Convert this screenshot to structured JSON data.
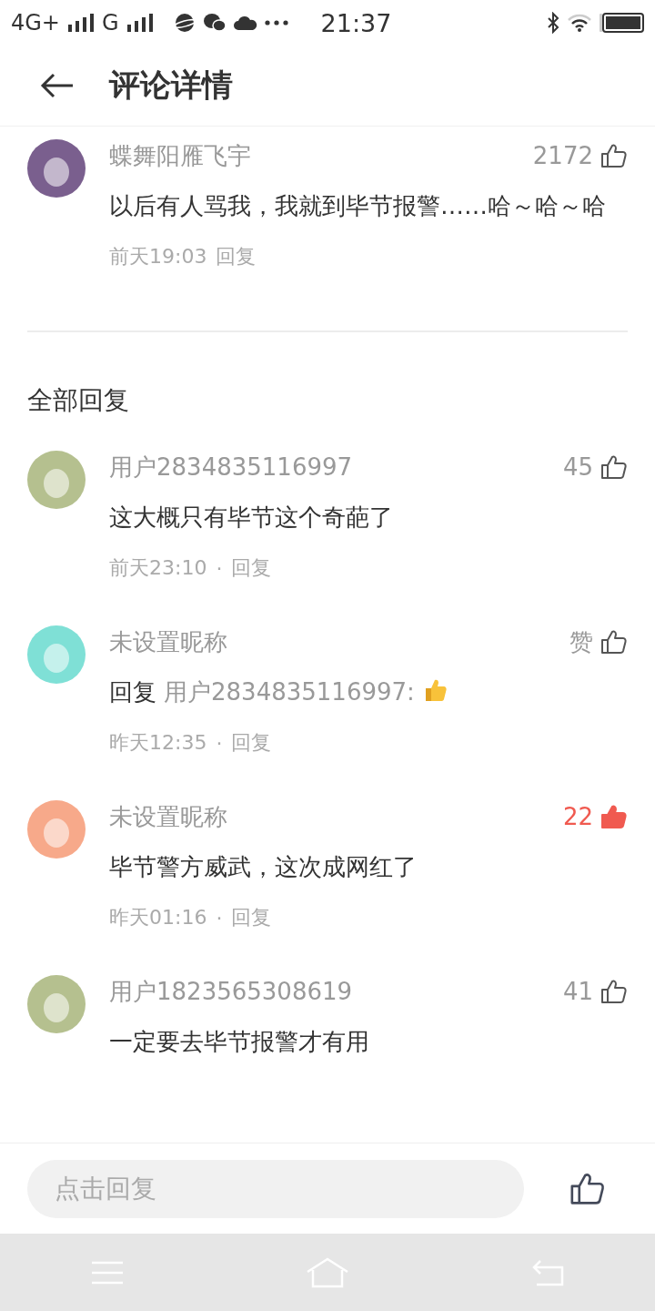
{
  "status_bar": {
    "network_1": "4G+",
    "network_2": "G",
    "time": "21:37"
  },
  "header": {
    "title": "评论详情"
  },
  "main_comment": {
    "color": "#7a5f8e",
    "user": "蝶舞阳雁飞宇",
    "likes": "2172",
    "liked": false,
    "body": [
      {
        "kind": "text",
        "text": "以后有人骂我，我就到毕节报警……哈～哈～哈"
      }
    ],
    "time": "前天19:03",
    "reply_label": "回复"
  },
  "replies_title": "全部回复",
  "replies": [
    {
      "color": "#b5c08f",
      "user": "用户2834835116997",
      "likes": "45",
      "liked": false,
      "body": [
        {
          "kind": "text",
          "text": "这大概只有毕节这个奇葩了"
        }
      ],
      "time": "前天23:10",
      "separator": "·",
      "reply_label": "回复"
    },
    {
      "color": "#7fe0d6",
      "user": "未设置昵称",
      "likes": "赞",
      "liked": false,
      "body": [
        {
          "kind": "text",
          "text": "回复"
        },
        {
          "kind": "mention",
          "text": "用户2834835116997:"
        },
        {
          "kind": "emoji"
        }
      ],
      "time": "昨天12:35",
      "separator": "·",
      "reply_label": "回复"
    },
    {
      "color": "#f7a98a",
      "user": "未设置昵称",
      "likes": "22",
      "liked": true,
      "body": [
        {
          "kind": "text",
          "text": "毕节警方威武，这次成网红了"
        }
      ],
      "time": "昨天01:16",
      "separator": "·",
      "reply_label": "回复"
    },
    {
      "color": "#b5c08f",
      "user": "用户1823565308619",
      "likes": "41",
      "liked": false,
      "body": [
        {
          "kind": "text",
          "text": "一定要去毕节报警才有用"
        }
      ]
    }
  ],
  "reply_bar": {
    "placeholder": "点击回复"
  }
}
